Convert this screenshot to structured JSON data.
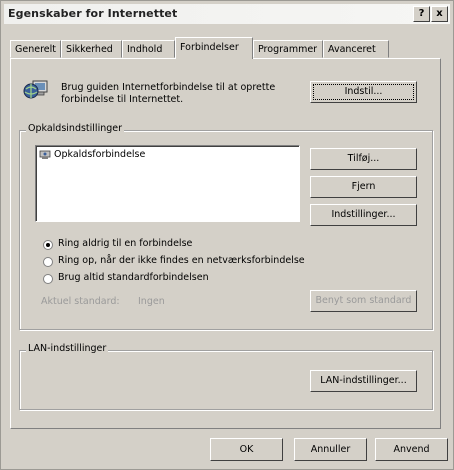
{
  "window": {
    "title": "Egenskaber for Internettet",
    "help_button": "?",
    "close_button": "x"
  },
  "tabs": [
    {
      "label": "Generelt"
    },
    {
      "label": "Sikkerhed"
    },
    {
      "label": "Indhold"
    },
    {
      "label": "Forbindelser",
      "active": true
    },
    {
      "label": "Programmer"
    },
    {
      "label": "Avanceret"
    }
  ],
  "setup": {
    "text_line1": "Brug guiden Internetforbindelse til at oprette",
    "text_line2": "forbindelse til Internettet.",
    "button": "Indstil..."
  },
  "dialup": {
    "group_label": "Opkaldsindstillinger",
    "list_items": [
      "Opkaldsforbindelse"
    ],
    "add_button": "Tilføj...",
    "remove_button": "Fjern",
    "settings_button": "Indstillinger...",
    "radios": [
      {
        "label": "Ring aldrig til en forbindelse",
        "selected": true
      },
      {
        "label": "Ring op, når der ikke findes en netværksforbindelse",
        "selected": false
      },
      {
        "label": "Brug altid standardforbindelsen",
        "selected": false
      }
    ],
    "current_default_label": "Aktuel standard:",
    "current_default_value": "Ingen",
    "set_default_button": "Benyt som standard"
  },
  "lan": {
    "group_label": "LAN-indstillinger",
    "button": "LAN-indstillinger..."
  },
  "footer": {
    "ok": "OK",
    "cancel": "Annuller",
    "apply": "Anvend"
  }
}
